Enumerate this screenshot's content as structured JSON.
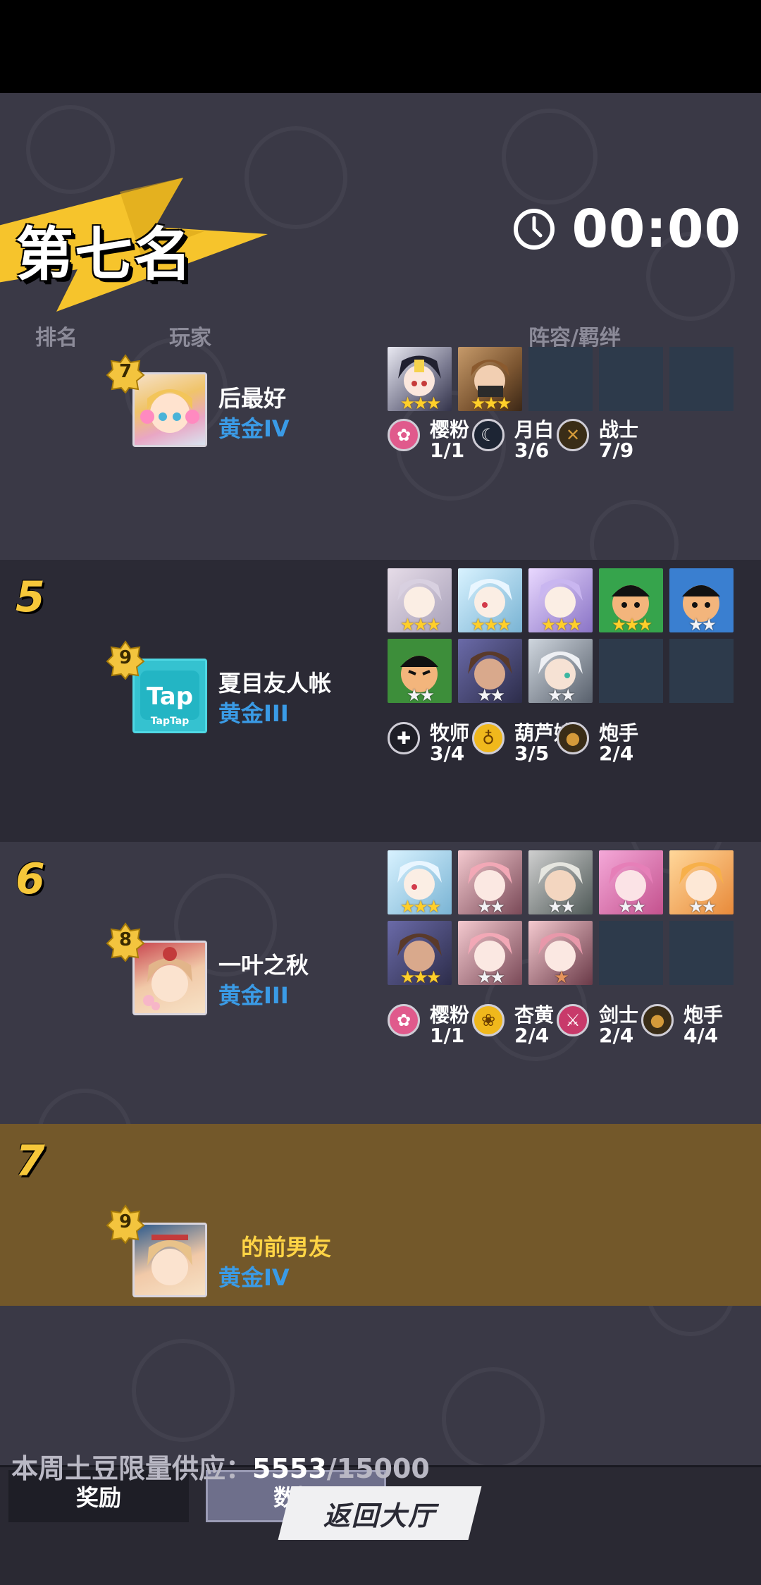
{
  "header": {
    "rank_title": "第七名",
    "timer": "00:00"
  },
  "columns": {
    "rank": "排名",
    "player": "玩家",
    "lineup": "阵容/羁绊"
  },
  "rows": [
    {
      "rank": "",
      "level": "7",
      "name": "后最好",
      "tier": "黄金IV",
      "synergies": [
        {
          "name": "樱粉",
          "count": "1/1",
          "icon": "sakura-icon"
        },
        {
          "name": "月白",
          "count": "3/6",
          "icon": "moon-icon"
        },
        {
          "name": "战士",
          "count": "7/9",
          "icon": "warrior-icon"
        }
      ]
    },
    {
      "rank": "5",
      "level": "9",
      "name": "夏目友人帐",
      "tier": "黄金III",
      "synergies": [
        {
          "name": "牧师",
          "count": "3/4",
          "icon": "priest-cross-icon"
        },
        {
          "name": "葫芦娃",
          "count": "3/5",
          "icon": "gourd-icon"
        },
        {
          "name": "炮手",
          "count": "2/4",
          "icon": "gunner-icon"
        }
      ]
    },
    {
      "rank": "6",
      "level": "8",
      "name": "一叶之秋",
      "tier": "黄金III",
      "synergies": [
        {
          "name": "樱粉",
          "count": "1/1",
          "icon": "sakura-icon"
        },
        {
          "name": "杏黄",
          "count": "2/4",
          "icon": "lotus-icon"
        },
        {
          "name": "剑士",
          "count": "2/4",
          "icon": "sword-icon"
        },
        {
          "name": "炮手",
          "count": "4/4",
          "icon": "gunner-icon"
        }
      ]
    },
    {
      "rank": "7",
      "level": "9",
      "name": "的前男友",
      "tier": "黄金IV",
      "synergies": []
    }
  ],
  "bottom": {
    "tab_reward": "奖励",
    "tab_data": "数据",
    "supply_label": "本周土豆限量供应：",
    "supply_current": "5553",
    "supply_total": "/15000",
    "return_button": "返回大厅"
  },
  "colors": {
    "background": "#3a3946",
    "row_alt": "#2b2a35",
    "row_self": "#73582a",
    "rank_number": "#f6c73a",
    "tier_text": "#3a9be6",
    "banner_yellow": "#f6c42c"
  }
}
